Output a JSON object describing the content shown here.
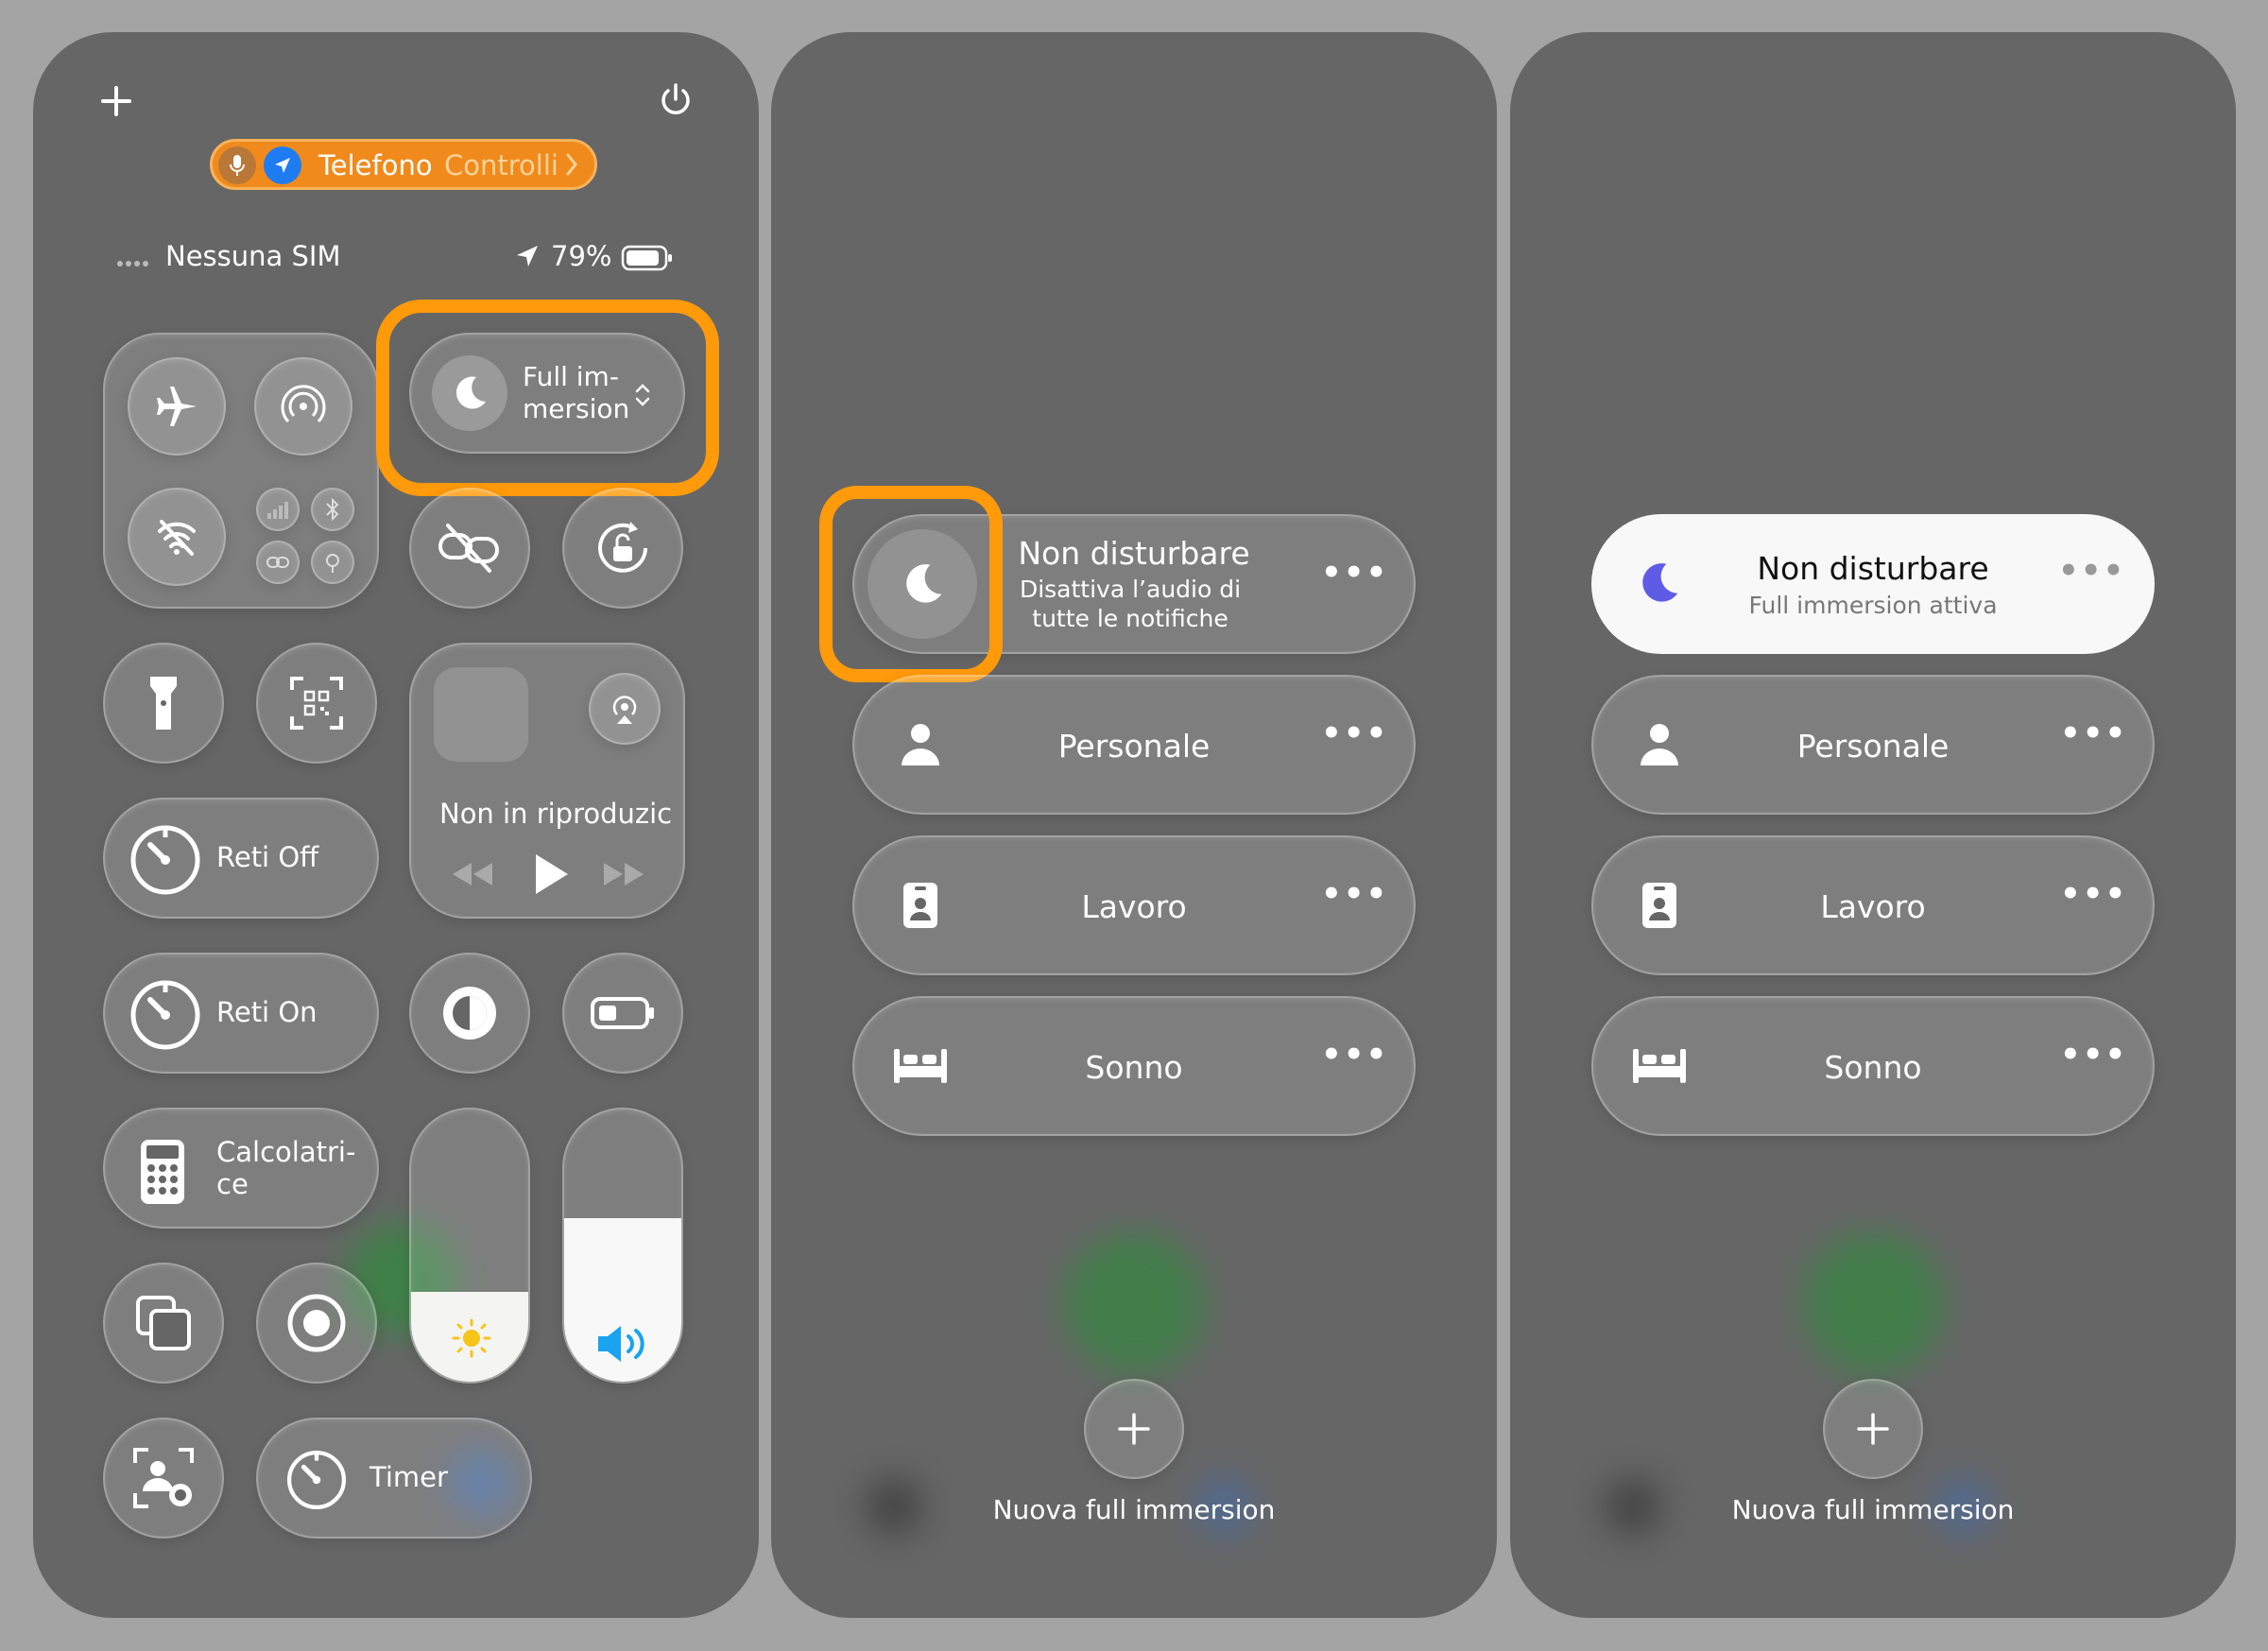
{
  "panel1": {
    "status_pill": {
      "app": "Telefono",
      "action": "Controlli"
    },
    "status_bar": {
      "carrier": "Nessuna SIM",
      "battery": "79%"
    },
    "focus_tile": {
      "label": "Full im-\nmersion"
    },
    "now_playing": {
      "text": "Non in riproduzic"
    },
    "reti_off": "Reti Off",
    "reti_on": "Reti On",
    "calculator": "Calcolatri-\nce",
    "timer": "Timer",
    "brightness_level": 0.33,
    "volume_level": 0.6
  },
  "panel2": {
    "dnd": {
      "title": "Non disturbare",
      "subtitle": "Disattiva l’audio di tutte le notifiche"
    },
    "personal": "Personale",
    "work": "Lavoro",
    "sleep": "Sonno",
    "new_focus": "Nuova full immersion"
  },
  "panel3": {
    "dnd": {
      "title": "Non disturbare",
      "subtitle": "Full immersion attiva"
    },
    "personal": "Personale",
    "work": "Lavoro",
    "sleep": "Sonno",
    "new_focus": "Nuova full immersion"
  },
  "colors": {
    "highlight": "#ff9a0a",
    "dnd_moon_active": "#5e5ce6",
    "status_orange": "#f08a1c"
  }
}
